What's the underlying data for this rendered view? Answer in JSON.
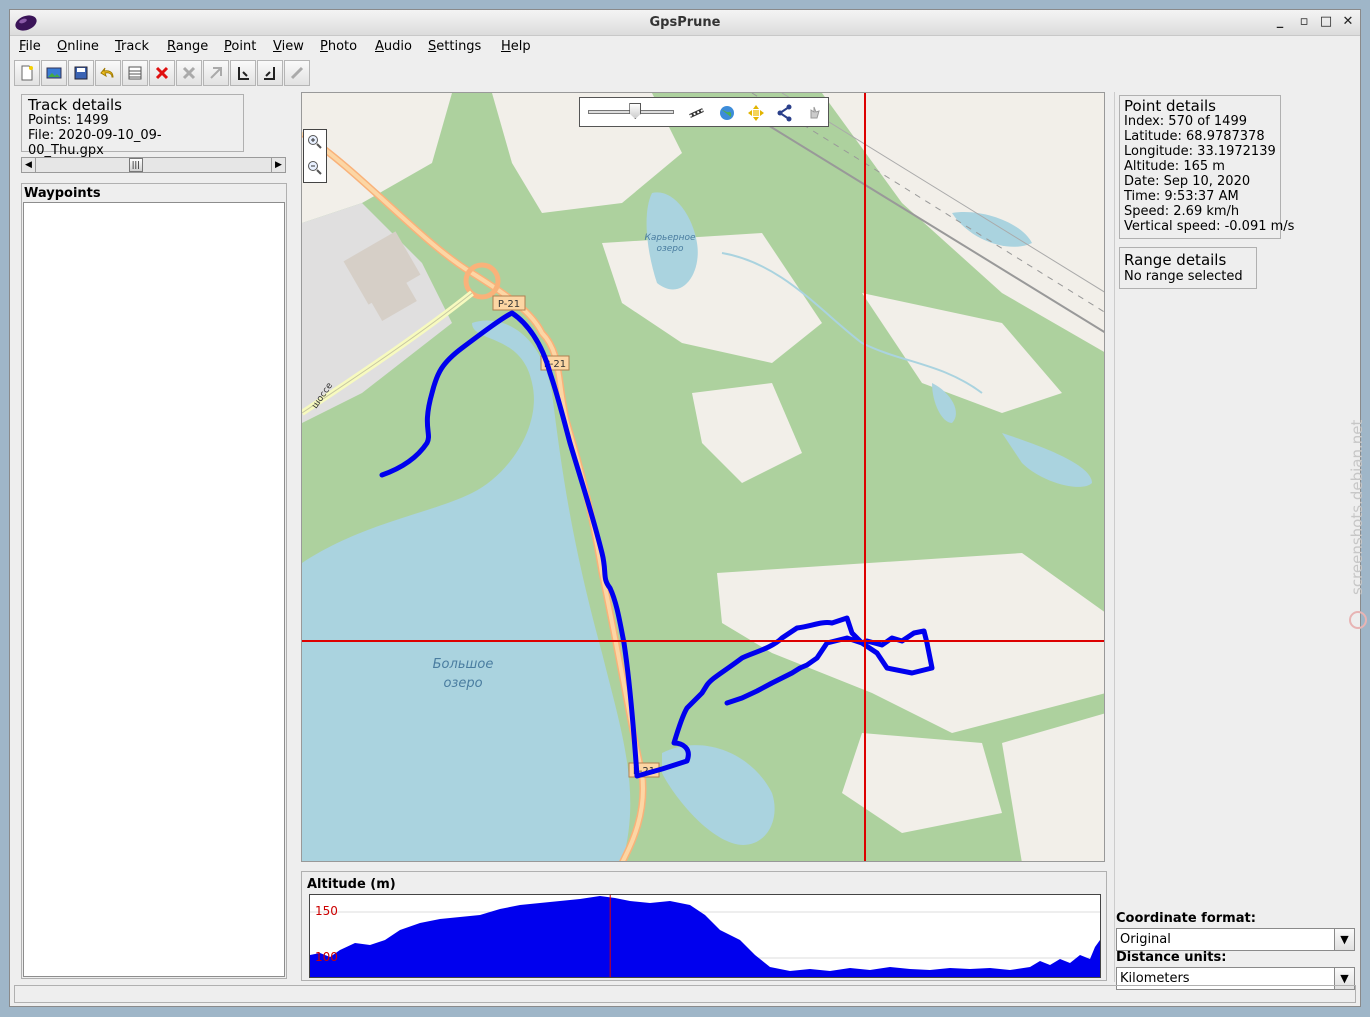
{
  "window": {
    "title": "GpsPrune"
  },
  "menu": [
    "File",
    "Online",
    "Track",
    "Range",
    "Point",
    "View",
    "Photo",
    "Audio",
    "Settings",
    "Help"
  ],
  "track_details": {
    "heading": "Track details",
    "points": "Points: 1499",
    "file": "File: 2020-09-10_09-00_Thu.gpx",
    "slider_position": 0.42
  },
  "waypoints": {
    "heading": "Waypoints"
  },
  "map": {
    "labels": {
      "road_1": "P-21",
      "road_2": "P-21",
      "road_3": "P-21",
      "lake_small_1": "Карьерное",
      "lake_small_2": "озеро",
      "lake_big_1": "Большое",
      "lake_big_2": "озеро",
      "highway": "шоссе"
    },
    "zoom_slider_level": 0.55,
    "colors": {
      "track": "#0000ee",
      "crosshair": "#dd0000",
      "water": "#aad3df",
      "forest": "#add19e",
      "land": "#f2efe9"
    }
  },
  "altitude": {
    "title": "Altitude (m)",
    "tick_150": "150",
    "tick_100": "100",
    "selected_fraction": 0.38
  },
  "point_details": {
    "heading": "Point details",
    "index": "Index: 570 of 1499",
    "latitude": "Latitude: 68.9787378",
    "longitude": "Longitude: 33.1972139",
    "altitude": "Altitude: 165 m",
    "date": "Date: Sep 10, 2020",
    "time": "Time: 9:53:37 AM",
    "speed": "Speed: 2.69 km/h",
    "vertical_speed": "Vertical speed: -0.091 m/s"
  },
  "range_details": {
    "heading": "Range details",
    "status": "No range selected"
  },
  "settings": {
    "coord_label": "Coordinate format:",
    "coord_value": "Original",
    "dist_label": "Distance units:",
    "dist_value": "Kilometers"
  },
  "watermark": "screenshots.debian.net"
}
